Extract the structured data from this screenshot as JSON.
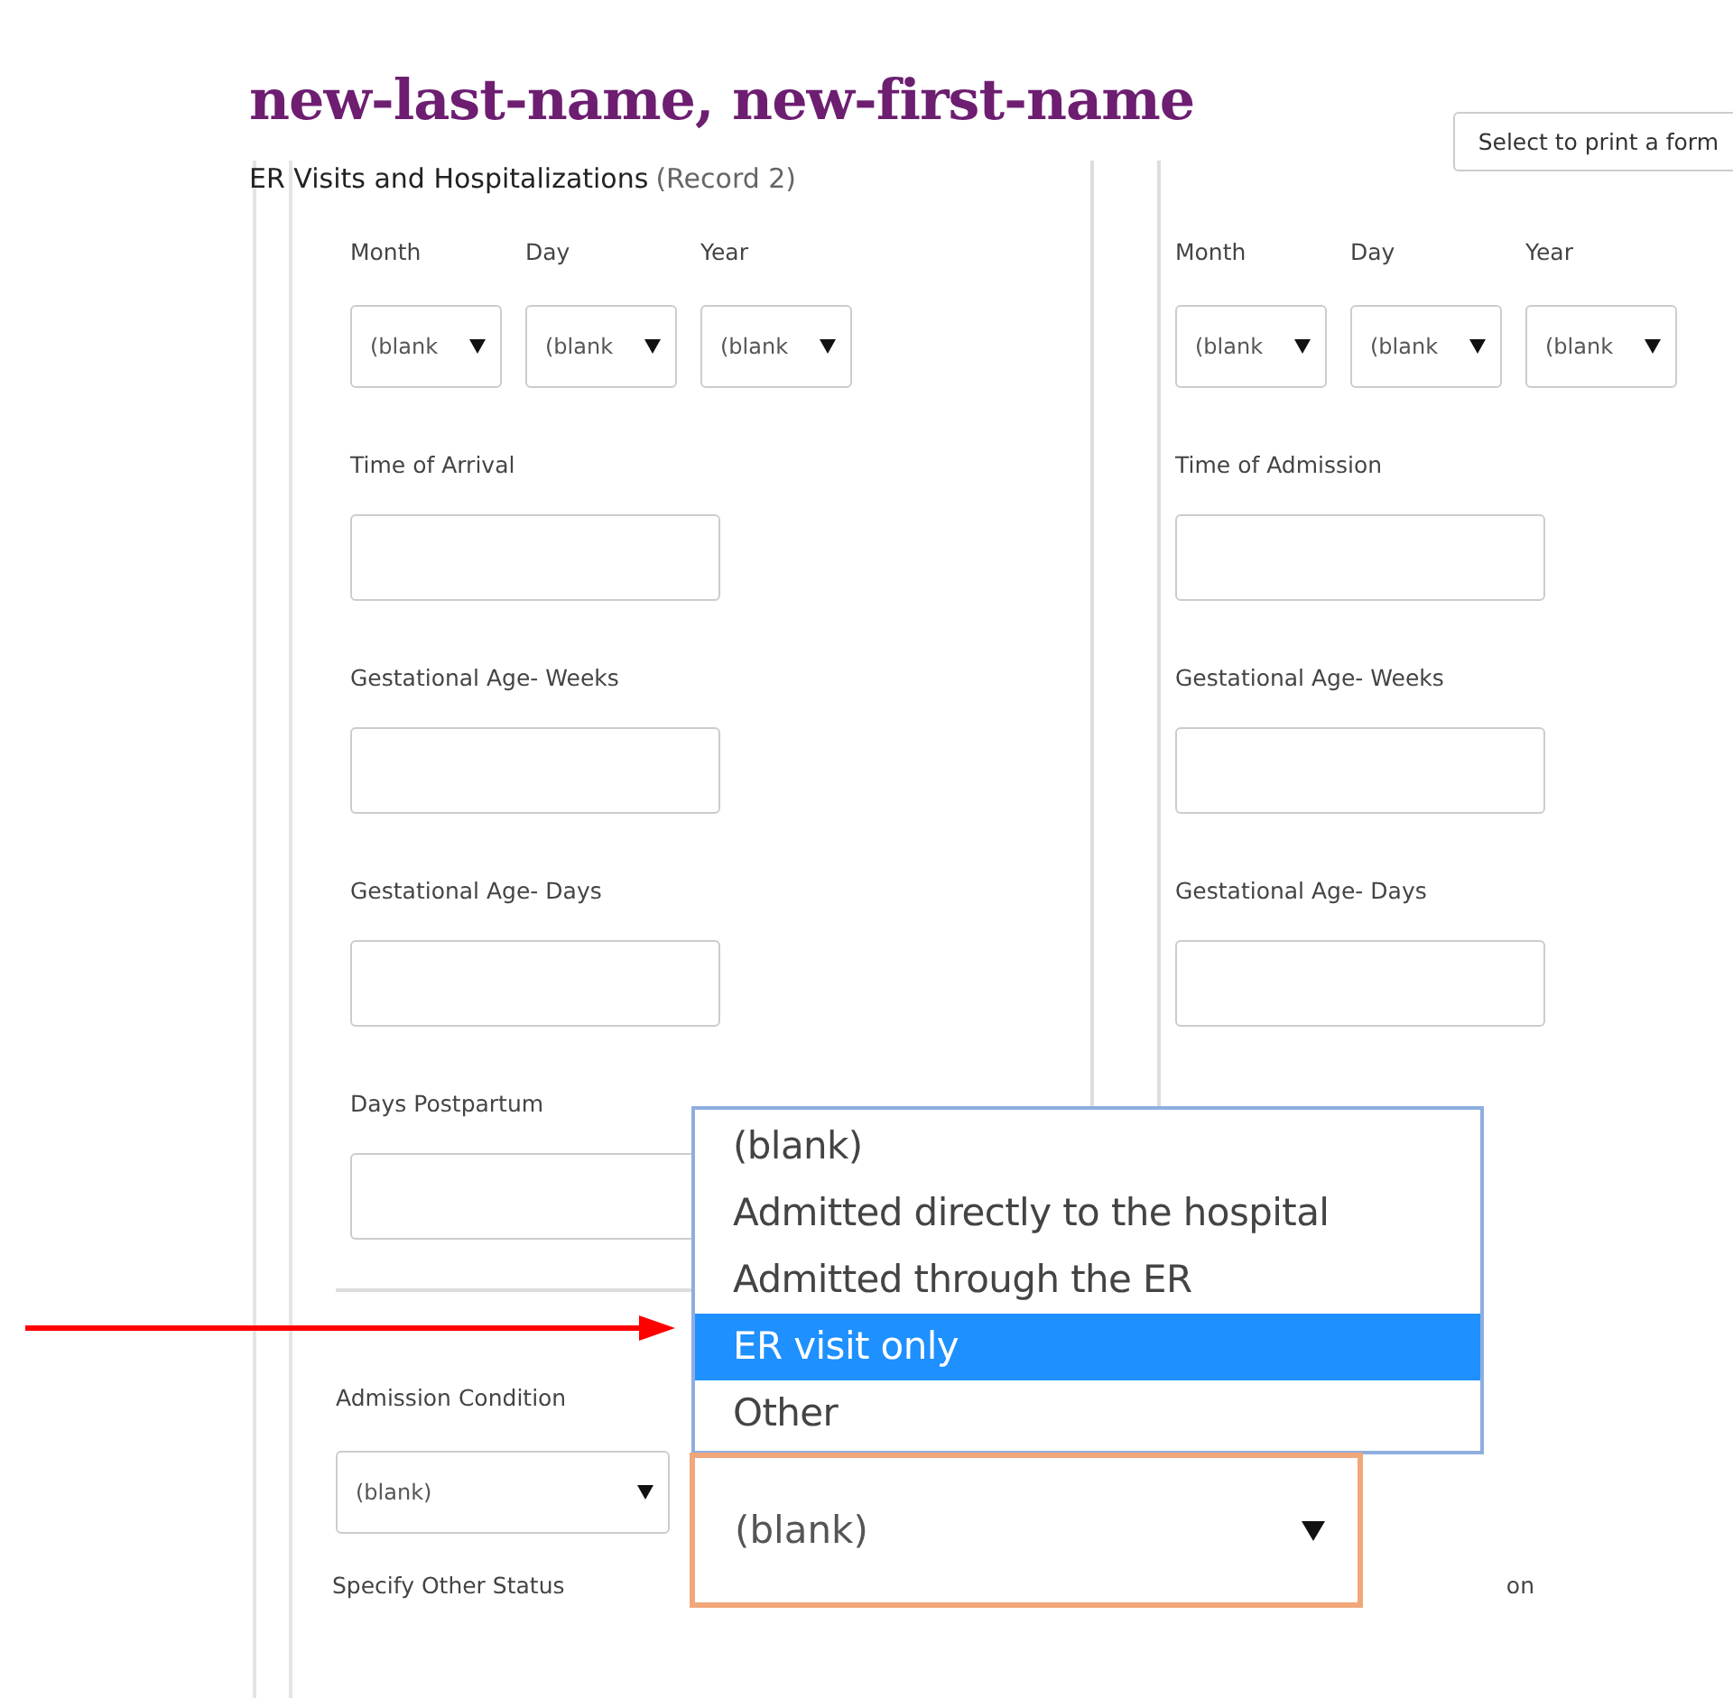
{
  "header": {
    "title": "new-last-name, new-first-name",
    "subtitle": "ER Visits and Hospitalizations",
    "record": "(Record 2)",
    "print_select": {
      "value": "Select to print a form"
    }
  },
  "panels": [
    {
      "date_fields": [
        {
          "label": "Month",
          "value": "(blank"
        },
        {
          "label": "Day",
          "value": "(blank"
        },
        {
          "label": "Year",
          "value": "(blank"
        }
      ],
      "fields": [
        {
          "label": "Time of Arrival"
        },
        {
          "label": "Gestational Age- Weeks"
        },
        {
          "label": "Gestational Age- Days"
        },
        {
          "label": "Days Postpartum"
        }
      ]
    },
    {
      "date_fields": [
        {
          "label": "Month",
          "value": "(blank"
        },
        {
          "label": "Day",
          "value": "(blank"
        },
        {
          "label": "Year",
          "value": "(blank"
        }
      ],
      "fields": [
        {
          "label": "Time of Admission"
        },
        {
          "label": "Gestational Age- Weeks"
        },
        {
          "label": "Gestational Age- Days"
        }
      ]
    }
  ],
  "admission_condition": {
    "label": "Admission Condition",
    "value": "(blank)"
  },
  "specify_other": {
    "label": "Specify Other Status",
    "column_3": "on"
  },
  "zoomed_select": {
    "value": "(blank)"
  },
  "dropdown": {
    "options": [
      {
        "label": "(blank)",
        "selected": false
      },
      {
        "label": "Admitted directly to the hospital",
        "selected": false
      },
      {
        "label": "Admitted through the ER",
        "selected": false
      },
      {
        "label": "ER visit only",
        "selected": true
      },
      {
        "label": "Other",
        "selected": false
      }
    ]
  }
}
